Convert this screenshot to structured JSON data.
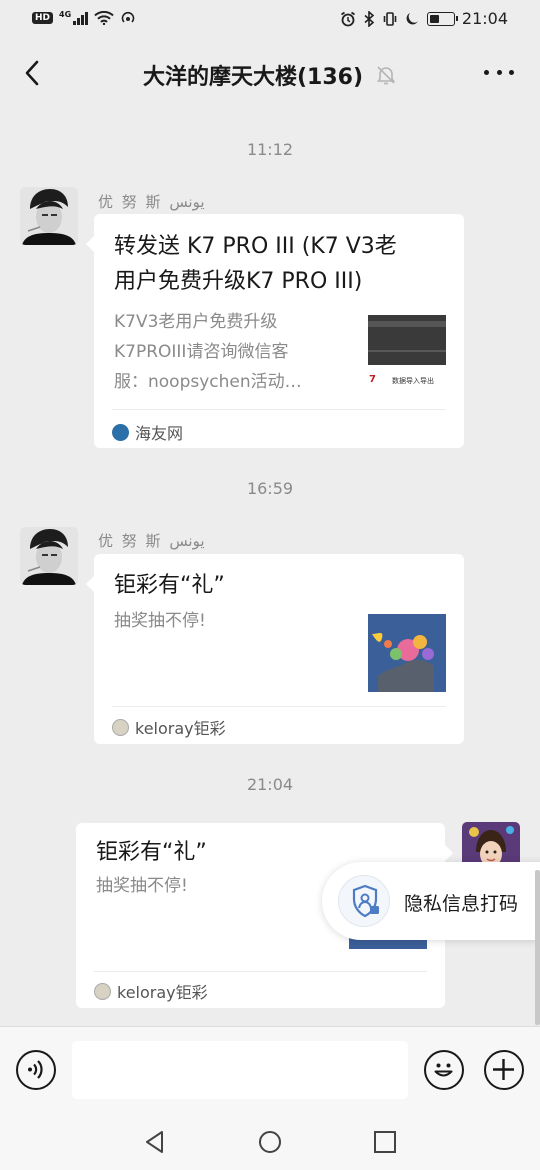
{
  "status_bar": {
    "hd": "HD",
    "network": "4G",
    "time": "21:04"
  },
  "header": {
    "title": "大洋的摩天大楼(136)"
  },
  "messages": [
    {
      "timestamp": "11:12",
      "sender": "优 努 斯  یونس",
      "card": {
        "title_line1": "转发送 K7 PRO III (K7 V3老",
        "title_line2": "用户免费升级K7 PRO III)",
        "desc_line1": "K7V3老用户免费升级",
        "desc_line2": "K7PROIII请咨询微信客",
        "desc_line3": "服：noopsychen活动…",
        "source": "海友网",
        "thumb_text": "数据导入导出"
      }
    },
    {
      "timestamp": "16:59",
      "sender": "优 努 斯  یونس",
      "card": {
        "title": "钜彩有“礼”",
        "desc": "抽奖抽不停!",
        "source": "keloray钜彩"
      }
    },
    {
      "timestamp": "21:04",
      "card": {
        "title": "钜彩有“礼”",
        "desc": "抽奖抽不停!",
        "source": "keloray钜彩"
      }
    }
  ],
  "privacy_button": {
    "label": "隐私信息打码"
  },
  "input_bar": {
    "placeholder": ""
  },
  "colors": {
    "background": "#ededed",
    "card": "#ffffff",
    "meta_text": "#8a8a8a",
    "accent_blue": "#3a6fb5"
  }
}
